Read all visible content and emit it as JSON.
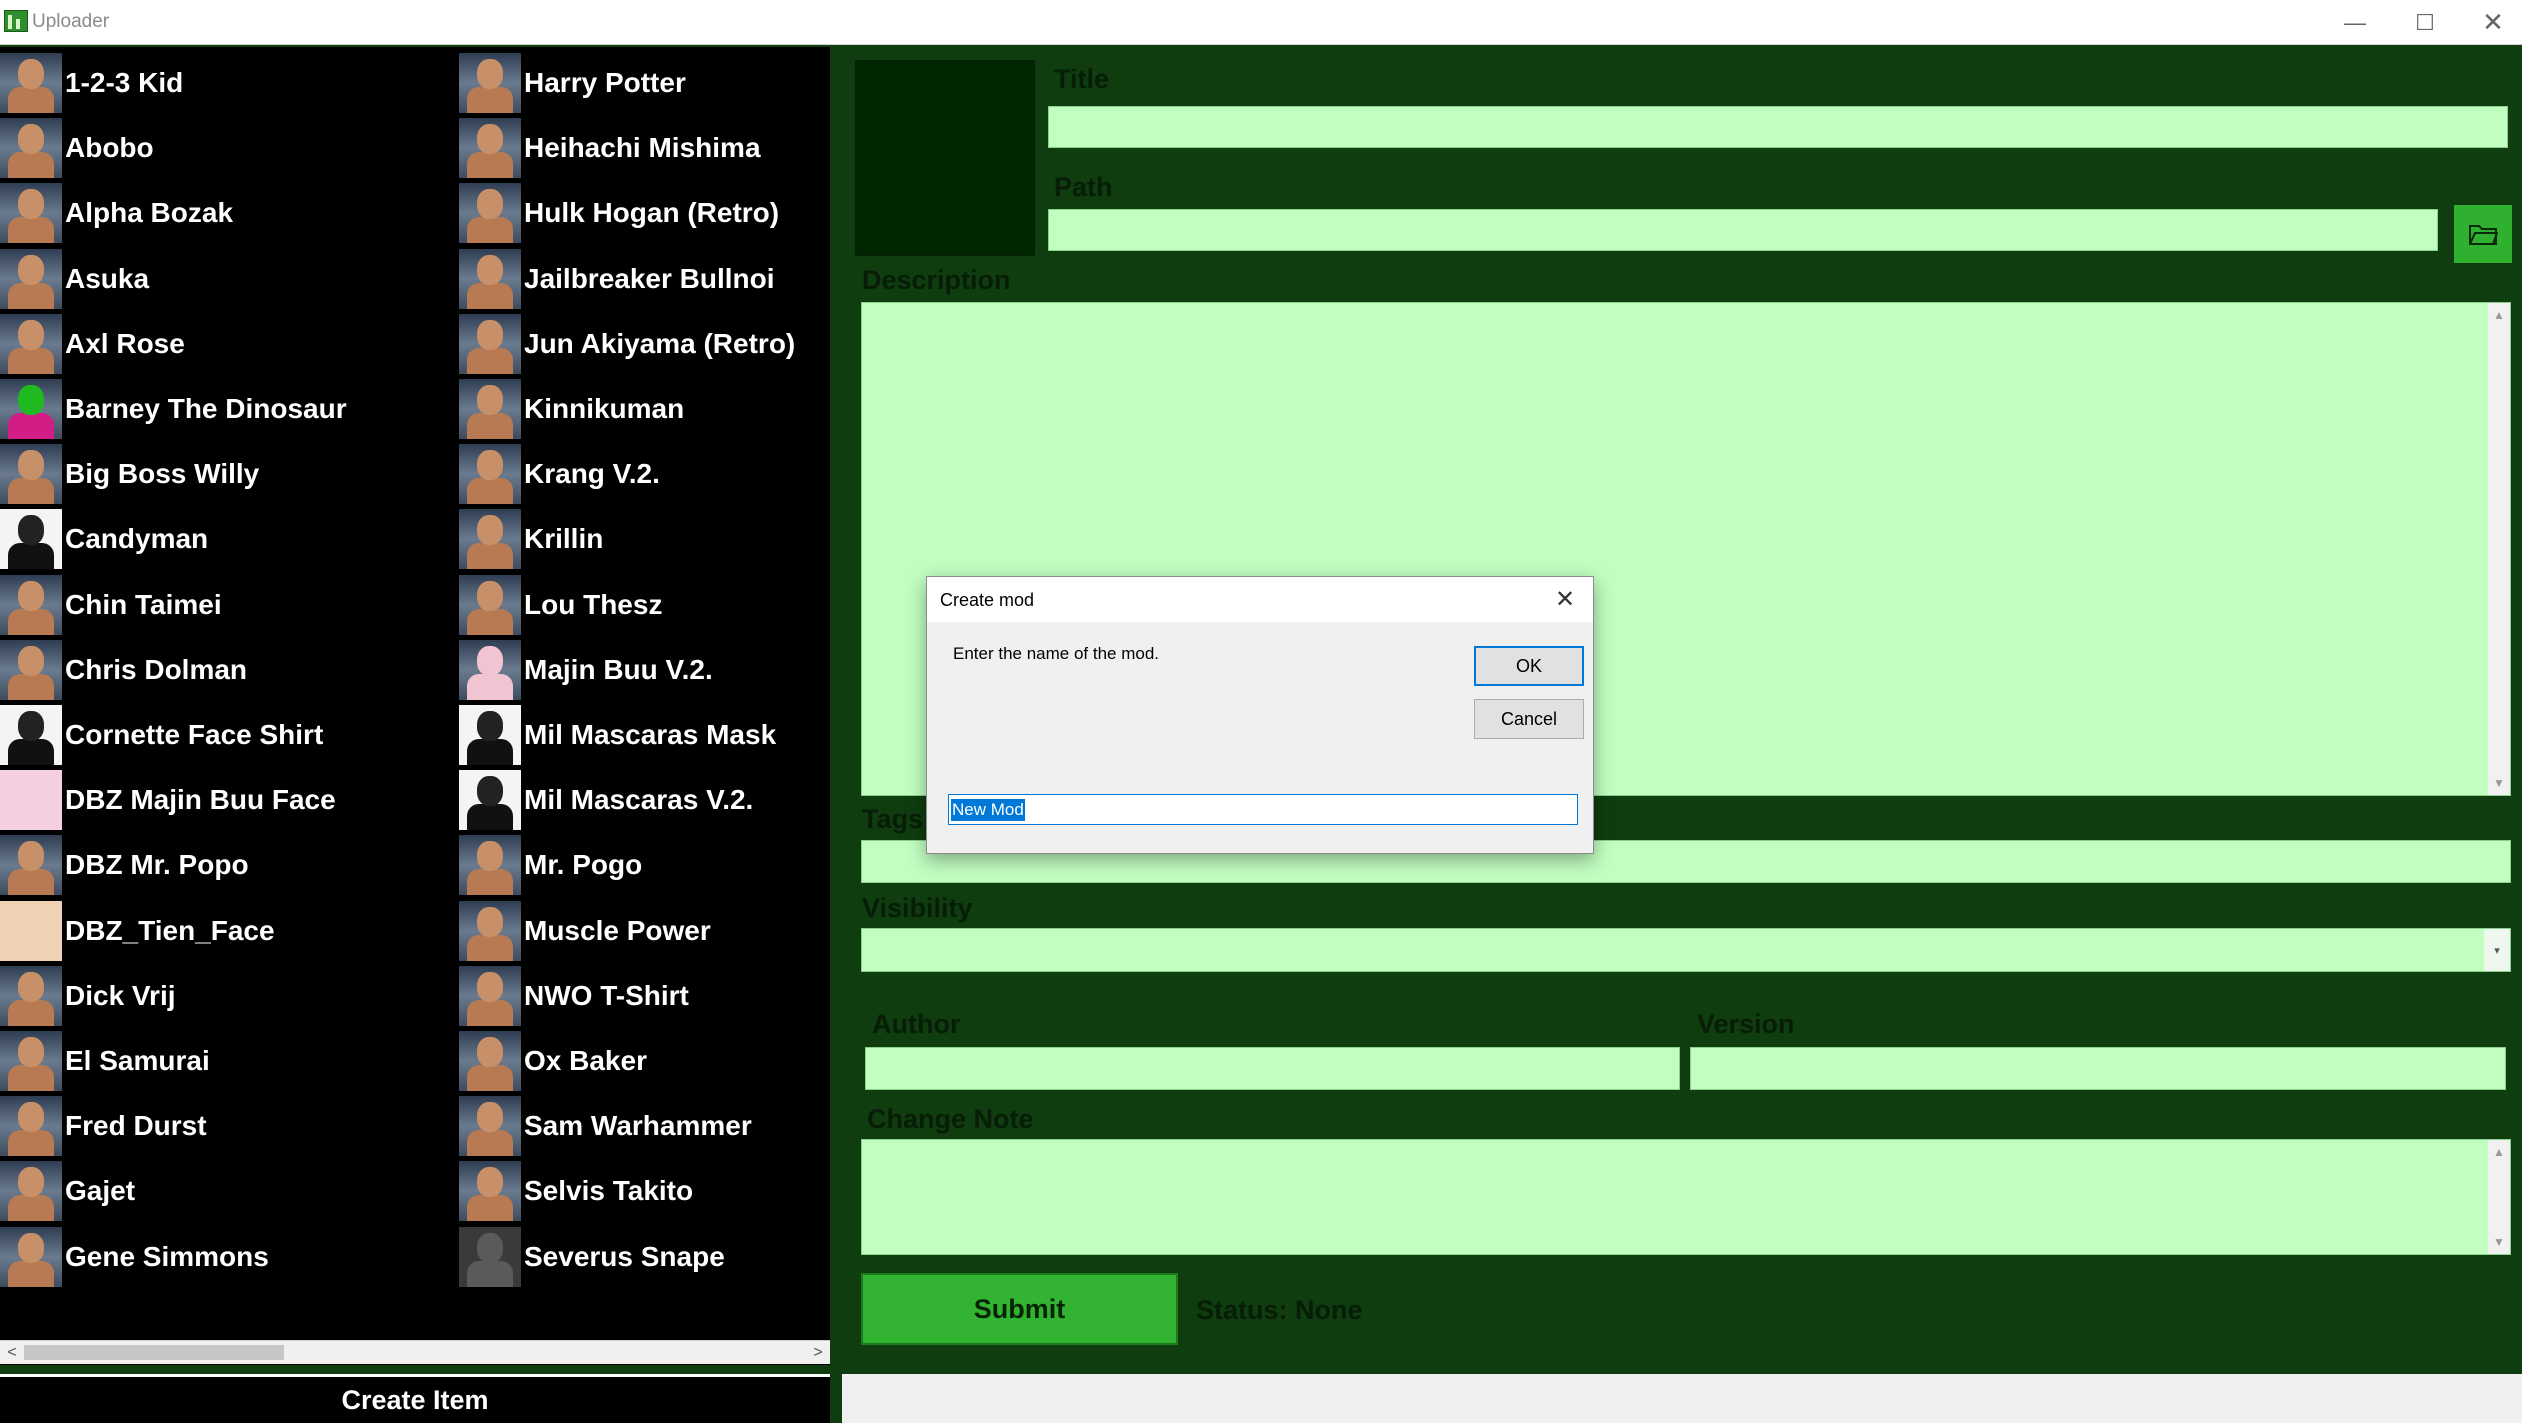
{
  "window": {
    "title": "Uploader",
    "min": "—",
    "max": "☐",
    "close": "✕"
  },
  "left": {
    "col1": [
      "1-2-3 Kid",
      "Abobo",
      "Alpha Bozak",
      "Asuka",
      "Axl Rose",
      "Barney The Dinosaur",
      "Big Boss Willy",
      "Candyman",
      "Chin Taimei",
      "Chris Dolman",
      "Cornette Face Shirt",
      "DBZ Majin Buu Face",
      "DBZ Mr. Popo",
      "DBZ_Tien_Face",
      "Dick Vrij",
      "El Samurai",
      "Fred Durst",
      "Gajet",
      "Gene Simmons"
    ],
    "col2": [
      "Harry Potter",
      "Heihachi Mishima",
      "Hulk Hogan (Retro)",
      "Jailbreaker Bullnoi",
      "Jun Akiyama (Retro)",
      "Kinnikuman",
      "Krang V.2.",
      "Krillin",
      "Lou Thesz",
      "Majin Buu V.2.",
      "Mil Mascaras Mask",
      "Mil Mascaras V.2.",
      "Mr. Pogo",
      "Muscle Power",
      "NWO T-Shirt",
      "Ox Baker",
      "Sam Warhammer",
      "Selvis Takito",
      "Severus Snape"
    ],
    "scroll_left": "<",
    "scroll_right": ">",
    "create_item": "Create Item"
  },
  "form": {
    "title_label": "Title",
    "path_label": "Path",
    "description_label": "Description",
    "tags_label": "Tags",
    "visibility_label": "Visibility",
    "author_label": "Author",
    "version_label": "Version",
    "change_note_label": "Change Note",
    "submit": "Submit",
    "status": "Status: None"
  },
  "dialog": {
    "title": "Create mod",
    "close": "✕",
    "prompt": "Enter the name of the mod.",
    "ok": "OK",
    "cancel": "Cancel",
    "input_value": "New Mod"
  },
  "colors": {
    "bg": "#0f3d0f",
    "field": "#c1ffc1",
    "button": "#32b432",
    "accent": "#0078d7"
  }
}
